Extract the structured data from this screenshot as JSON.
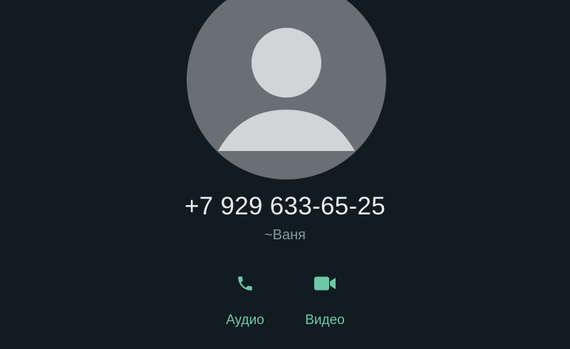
{
  "contact": {
    "phone": "+7 929 633-65-25",
    "name": "~Ваня"
  },
  "actions": {
    "audio_label": "Аудио",
    "video_label": "Видео"
  },
  "icons": {
    "avatar": "default-person-avatar",
    "audio": "phone-icon",
    "video": "video-camera-icon"
  },
  "colors": {
    "background": "#111b21",
    "accent": "#6fc7a6",
    "secondary_text": "#8696a0",
    "primary_text": "#e9edef",
    "avatar_bg": "#6a6f74",
    "avatar_fg": "#d2d5d8"
  }
}
